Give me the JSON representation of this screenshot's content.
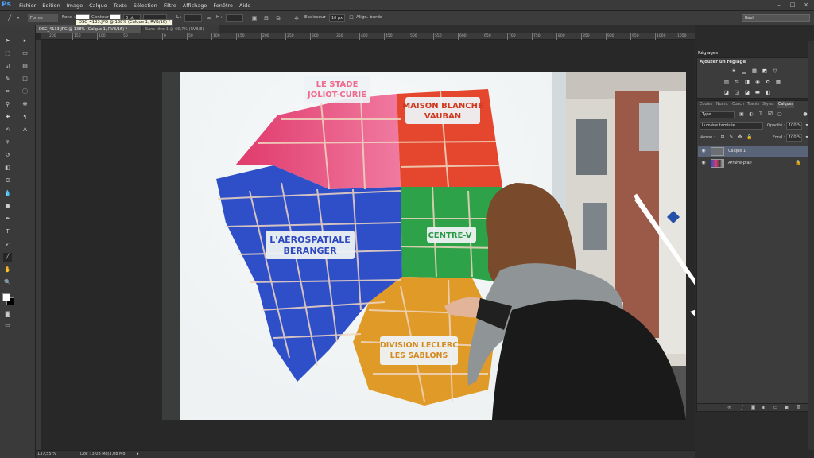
{
  "app": {
    "logo": "Ps"
  },
  "menu": [
    "Fichier",
    "Edition",
    "Image",
    "Calque",
    "Texte",
    "Sélection",
    "Filtre",
    "Affichage",
    "Fenêtre",
    "Aide"
  ],
  "window_controls": {
    "minimize": "–",
    "maximize": "□",
    "close": "×"
  },
  "options": {
    "mode": "Forme",
    "fill_label": "Fond :",
    "stroke_label": "Contour :",
    "stroke_size": "3 pt",
    "width_label": "L :",
    "height_label": "H :",
    "weight_label": "Epaisseur :",
    "weight_value": "10 px",
    "align_label": "Align. bords",
    "preset": "Réel"
  },
  "tooltip": "DSC_4133.JPG @ 138% (Calque 1, RVB/16) *",
  "tabs": [
    {
      "label": "DSC_4133.JPG @ 138% (Calque 1, RVB/16) *"
    },
    {
      "label": "Sans titre-1 @ 66,7% (RVB/8)"
    }
  ],
  "ruler_ticks": [
    "200",
    "150",
    "100",
    "50",
    "0",
    "50",
    "100",
    "150",
    "200",
    "250",
    "300",
    "350",
    "400",
    "450",
    "500",
    "550",
    "600",
    "650",
    "700",
    "750",
    "800",
    "850",
    "900",
    "950",
    "1000",
    "1050"
  ],
  "map_labels": {
    "stade": "LE STADE\nJOLIOT-CURIE",
    "maison": "MAISON BLANCHE\nVAUBAN",
    "aero": "L'AÉROSPATIALE\nBÉRANGER",
    "centre": "CENTRE-V",
    "division": "DIVISION LECLERC\nLES SABLONS"
  },
  "status": {
    "zoom": "137,55 %",
    "doc": "Doc : 3,08 Mo/3,08 Mo"
  },
  "adjust": {
    "tab": "Réglages",
    "header": "Ajouter un réglage"
  },
  "layers": {
    "tabs": [
      "Coules",
      "Nuanc",
      "Coach",
      "Tracés",
      "Styles",
      "Calques"
    ],
    "filter": "Type",
    "blend_mode": "Lumière tamisée",
    "opacity_label": "Opacité :",
    "opacity": "100 %",
    "lock_label": "Verrou :",
    "fill_label": "Fond :",
    "fill": "100 %",
    "items": [
      {
        "name": "Calque 1",
        "selected": true
      },
      {
        "name": "Arrière-plan",
        "selected": false
      }
    ]
  }
}
